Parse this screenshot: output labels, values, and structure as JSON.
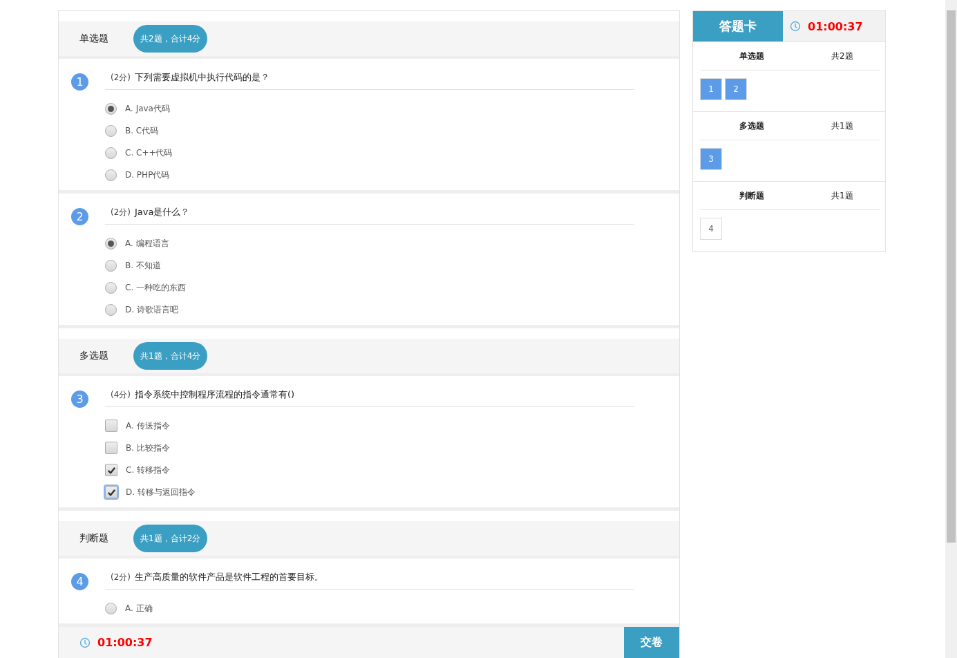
{
  "sections": [
    {
      "title": "单选题",
      "summary": "共2题，合计4分",
      "questions": [
        {
          "number": "1",
          "score": "(2分)",
          "text": "下列需要虚拟机中执行代码的是？",
          "kind": "radio",
          "options": [
            {
              "label": "A. Java代码",
              "checked": true,
              "focused": false
            },
            {
              "label": "B. C代码",
              "checked": false,
              "focused": false
            },
            {
              "label": "C. C++代码",
              "checked": false,
              "focused": false
            },
            {
              "label": "D. PHP代码",
              "checked": false,
              "focused": false
            }
          ]
        },
        {
          "number": "2",
          "score": "(2分)",
          "text": "Java是什么？",
          "kind": "radio",
          "options": [
            {
              "label": "A. 编程语言",
              "checked": true,
              "focused": false
            },
            {
              "label": "B. 不知道",
              "checked": false,
              "focused": false
            },
            {
              "label": "C. 一种吃的东西",
              "checked": false,
              "focused": false
            },
            {
              "label": "D. 诗歌语言吧",
              "checked": false,
              "focused": false
            }
          ]
        }
      ]
    },
    {
      "title": "多选题",
      "summary": "共1题，合计4分",
      "questions": [
        {
          "number": "3",
          "score": "(4分)",
          "text": "指令系统中控制程序流程的指令通常有()",
          "kind": "checkbox",
          "options": [
            {
              "label": "A. 传送指令",
              "checked": false,
              "focused": false
            },
            {
              "label": "B. 比较指令",
              "checked": false,
              "focused": false
            },
            {
              "label": "C. 转移指令",
              "checked": true,
              "focused": false
            },
            {
              "label": "D. 转移与返回指令",
              "checked": true,
              "focused": true
            }
          ]
        }
      ]
    },
    {
      "title": "判断题",
      "summary": "共1题，合计2分",
      "questions": [
        {
          "number": "4",
          "score": "(2分)",
          "text": "生产高质量的软件产品是软件工程的首要目标。",
          "kind": "radio",
          "options": [
            {
              "label": "A. 正确",
              "checked": false,
              "focused": false
            }
          ]
        }
      ]
    }
  ],
  "footer": {
    "timer": "01:00:37",
    "submit": "交卷"
  },
  "answer_card": {
    "title": "答题卡",
    "timer": "01:00:37",
    "groups": [
      {
        "title": "单选题",
        "count": "共2题",
        "items": [
          {
            "number": "1",
            "answered": true
          },
          {
            "number": "2",
            "answered": true
          }
        ]
      },
      {
        "title": "多选题",
        "count": "共1题",
        "items": [
          {
            "number": "3",
            "answered": true
          }
        ]
      },
      {
        "title": "判断题",
        "count": "共1题",
        "items": [
          {
            "number": "4",
            "answered": false
          }
        ]
      }
    ]
  }
}
